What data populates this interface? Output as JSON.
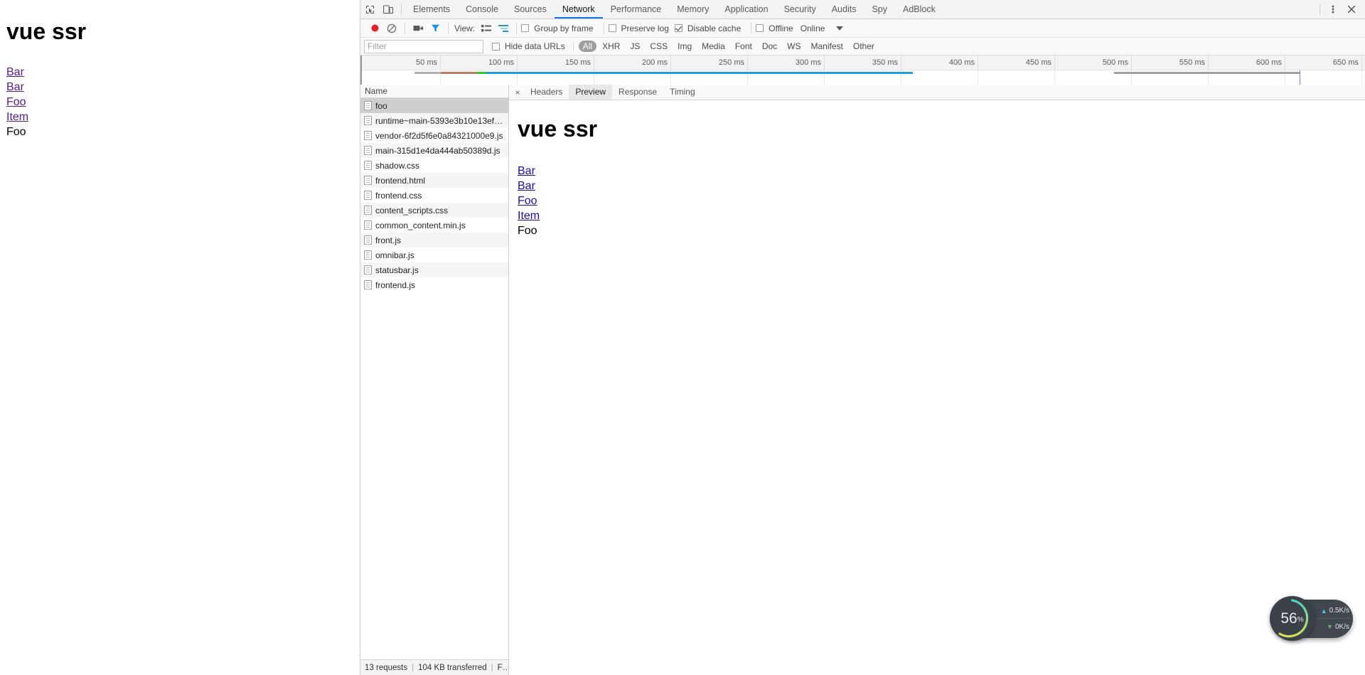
{
  "page": {
    "title": "vue ssr",
    "links": [
      {
        "label": "Bar",
        "type": "link"
      },
      {
        "label": "Bar",
        "type": "link"
      },
      {
        "label": "Foo",
        "type": "link"
      },
      {
        "label": "Item",
        "type": "link"
      },
      {
        "label": "Foo",
        "type": "text"
      }
    ]
  },
  "devtools": {
    "tabs": [
      {
        "label": "Elements",
        "active": false
      },
      {
        "label": "Console",
        "active": false
      },
      {
        "label": "Sources",
        "active": false
      },
      {
        "label": "Network",
        "active": true
      },
      {
        "label": "Performance",
        "active": false
      },
      {
        "label": "Memory",
        "active": false
      },
      {
        "label": "Application",
        "active": false
      },
      {
        "label": "Security",
        "active": false
      },
      {
        "label": "Audits",
        "active": false
      },
      {
        "label": "Spy",
        "active": false
      },
      {
        "label": "AdBlock",
        "active": false
      }
    ],
    "icons": {
      "inspect": "inspect-element-icon",
      "device": "device-toolbar-icon",
      "more": "more-options-icon",
      "close": "close-devtools-icon"
    },
    "toolbar": {
      "record_label": "record-button",
      "clear_label": "clear-button",
      "capture_screenshots_label": "camera-button",
      "filter_label": "filter-button",
      "view_label": "View:",
      "view_large_rows": "large-request-rows-icon",
      "view_waterfall": "show-overview-icon",
      "group_by_frame": "Group by frame",
      "group_by_frame_checked": false,
      "preserve_log": "Preserve log",
      "preserve_log_checked": false,
      "disable_cache": "Disable cache",
      "disable_cache_checked": true,
      "offline": "Offline",
      "offline_checked": false,
      "throttling": "Online"
    },
    "filterbar": {
      "filter_placeholder": "Filter",
      "filter_value": "",
      "hide_data_urls": "Hide data URLs",
      "hide_data_urls_checked": false,
      "types": [
        {
          "label": "All",
          "active": true
        },
        {
          "label": "XHR",
          "active": false
        },
        {
          "label": "JS",
          "active": false
        },
        {
          "label": "CSS",
          "active": false
        },
        {
          "label": "Img",
          "active": false
        },
        {
          "label": "Media",
          "active": false
        },
        {
          "label": "Font",
          "active": false
        },
        {
          "label": "Doc",
          "active": false
        },
        {
          "label": "WS",
          "active": false
        },
        {
          "label": "Manifest",
          "active": false
        },
        {
          "label": "Other",
          "active": false
        }
      ]
    },
    "overview": {
      "ticks": [
        "50 ms",
        "100 ms",
        "150 ms",
        "200 ms",
        "250 ms",
        "300 ms",
        "350 ms",
        "400 ms",
        "450 ms",
        "500 ms",
        "550 ms",
        "600 ms",
        "650 ms"
      ],
      "tick_spacing_px": 108,
      "bars": [
        {
          "name": "request-stalled-bar",
          "left_pct": 5.4,
          "width_pct": 2.6,
          "color": "#b0b0b0"
        },
        {
          "name": "request-download-bar",
          "left_pct": 8.0,
          "width_pct": 3.6,
          "color": "#b57f62"
        },
        {
          "name": "request-finish-bar",
          "left_pct": 11.6,
          "width_pct": 0.9,
          "color": "#2fcb2f"
        },
        {
          "name": "request-loading-bar",
          "left_pct": 12.5,
          "width_pct": 42.5,
          "color": "#1ba0e3"
        },
        {
          "name": "request-idle-bar",
          "left_pct": 75.0,
          "width_pct": 18.5,
          "color": "#a0a0a0"
        }
      ],
      "dom_marker_pct": 93.5,
      "marker_color": "#7b7bdc"
    },
    "requests": {
      "column_header": "Name",
      "rows": [
        {
          "name": "foo",
          "selected": true
        },
        {
          "name": "runtime~main-5393e3b10e13ef…",
          "selected": false
        },
        {
          "name": "vendor-6f2d5f6e0a84321000e9.js",
          "selected": false
        },
        {
          "name": "main-315d1e4da444ab50389d.js",
          "selected": false
        },
        {
          "name": "shadow.css",
          "selected": false
        },
        {
          "name": "frontend.html",
          "selected": false
        },
        {
          "name": "frontend.css",
          "selected": false
        },
        {
          "name": "content_scripts.css",
          "selected": false
        },
        {
          "name": "common_content.min.js",
          "selected": false
        },
        {
          "name": "front.js",
          "selected": false
        },
        {
          "name": "omnibar.js",
          "selected": false
        },
        {
          "name": "statusbar.js",
          "selected": false
        },
        {
          "name": "frontend.js",
          "selected": false
        }
      ],
      "status": {
        "requests": "13 requests",
        "transferred": "104 KB transferred",
        "finish": "F…"
      }
    },
    "detail": {
      "tabs": [
        {
          "label": "Headers",
          "active": false
        },
        {
          "label": "Preview",
          "active": true
        },
        {
          "label": "Response",
          "active": false
        },
        {
          "label": "Timing",
          "active": false
        }
      ],
      "close_icon": "×",
      "preview": {
        "title": "vue ssr",
        "links": [
          {
            "label": "Bar",
            "type": "link"
          },
          {
            "label": "Bar",
            "type": "link"
          },
          {
            "label": "Foo",
            "type": "link"
          },
          {
            "label": "Item",
            "type": "link"
          },
          {
            "label": "Foo",
            "type": "text"
          }
        ]
      }
    }
  },
  "netspeed": {
    "percent": "56",
    "percent_suffix": "%",
    "upload": "0.5K/s",
    "download": "0K/s",
    "ring_color_start": "#4dd0c0",
    "ring_color_end": "#d4e157"
  }
}
